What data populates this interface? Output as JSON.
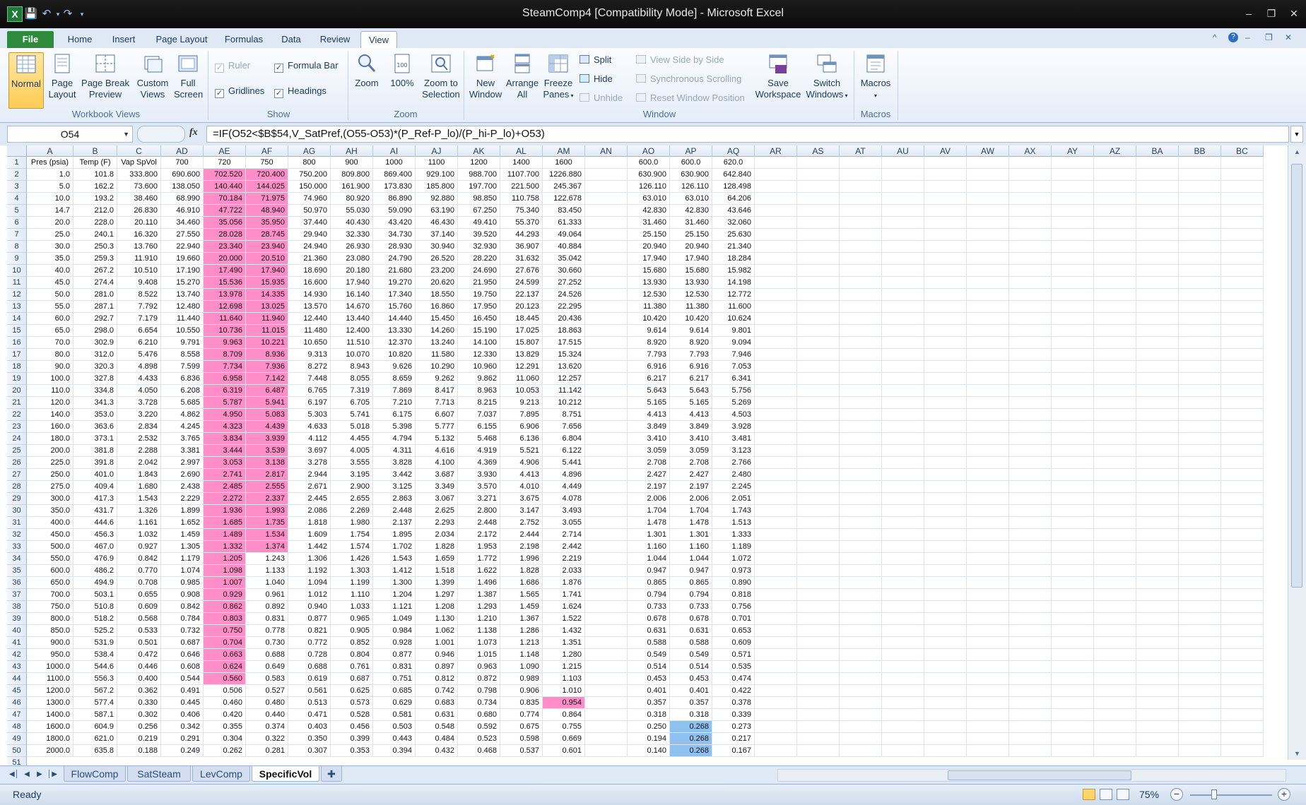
{
  "window": {
    "title": "SteamComp4  [Compatibility Mode]  -  Microsoft Excel",
    "app_icon": "X"
  },
  "ribbon_tabs": [
    "File",
    "Home",
    "Insert",
    "Page Layout",
    "Formulas",
    "Data",
    "Review",
    "View"
  ],
  "active_tab": "View",
  "ribbon": {
    "workbook_views": {
      "label": "Workbook Views",
      "normal": "Normal",
      "page_layout": [
        "Page",
        "Layout"
      ],
      "page_break": [
        "Page Break",
        "Preview"
      ],
      "custom_views": [
        "Custom",
        "Views"
      ],
      "full_screen": [
        "Full",
        "Screen"
      ]
    },
    "show": {
      "label": "Show",
      "ruler": "Ruler",
      "formula_bar": "Formula Bar",
      "gridlines": "Gridlines",
      "headings": "Headings",
      "ruler_checked": true,
      "formula_bar_checked": true,
      "gridlines_checked": true,
      "headings_checked": true
    },
    "zoom": {
      "label": "Zoom",
      "zoom": "Zoom",
      "hundred": "100%",
      "zoom_selection": [
        "Zoom to",
        "Selection"
      ]
    },
    "window": {
      "label": "Window",
      "new_window": [
        "New",
        "Window"
      ],
      "arrange_all": [
        "Arrange",
        "All"
      ],
      "freeze_panes": [
        "Freeze",
        "Panes"
      ],
      "split": "Split",
      "hide": "Hide",
      "unhide": "Unhide",
      "side_by_side": "View Side by Side",
      "sync_scroll": "Synchronous Scrolling",
      "reset_pos": "Reset Window Position",
      "save_workspace": [
        "Save",
        "Workspace"
      ],
      "switch_windows": [
        "Switch",
        "Windows"
      ]
    },
    "macros": {
      "label": "Macros",
      "macros": "Macros"
    }
  },
  "formula_bar": {
    "name_box": "O54",
    "fx": "fx",
    "formula": "=IF(O52<$B$54,V_SatPref,(O55-O53)*(P_Ref-P_lo)/(P_hi-P_lo)+O53)"
  },
  "sheet": {
    "columns": [
      "A",
      "B",
      "C",
      "AD",
      "AE",
      "AF",
      "AG",
      "AH",
      "AI",
      "AJ",
      "AK",
      "AL",
      "AM",
      "AN",
      "AO",
      "AP",
      "AQ",
      "AR",
      "AS",
      "AT",
      "AU",
      "AV",
      "AW",
      "AX",
      "AY",
      "AZ",
      "BA",
      "BB",
      "BC"
    ],
    "header_row": [
      "Pres (psia)",
      "Temp (F)",
      "Vap SpVol",
      "700",
      "720",
      "750",
      "800",
      "900",
      "1000",
      "1100",
      "1200",
      "1400",
      "1600",
      "",
      "600.0",
      "600.0",
      "620.0"
    ],
    "rows": [
      [
        "1.0",
        "101.8",
        "333.800",
        "690.600",
        "702.520",
        "720.400",
        "750.200",
        "809.800",
        "869.400",
        "929.100",
        "988.700",
        "1107.700",
        "1226.880",
        "",
        "630.900",
        "630.900",
        "642.840"
      ],
      [
        "5.0",
        "162.2",
        "73.600",
        "138.050",
        "140.440",
        "144.025",
        "150.000",
        "161.900",
        "173.830",
        "185.800",
        "197.700",
        "221.500",
        "245.367",
        "",
        "126.110",
        "126.110",
        "128.498"
      ],
      [
        "10.0",
        "193.2",
        "38.460",
        "68.990",
        "70.184",
        "71.975",
        "74.960",
        "80.920",
        "86.890",
        "92.880",
        "98.850",
        "110.758",
        "122.678",
        "",
        "63.010",
        "63.010",
        "64.206"
      ],
      [
        "14.7",
        "212.0",
        "26.830",
        "46.910",
        "47.722",
        "48.940",
        "50.970",
        "55.030",
        "59.090",
        "63.190",
        "67.250",
        "75.340",
        "83.450",
        "",
        "42.830",
        "42.830",
        "43.646"
      ],
      [
        "20.0",
        "228.0",
        "20.110",
        "34.460",
        "35.056",
        "35.950",
        "37.440",
        "40.430",
        "43.420",
        "46.430",
        "49.410",
        "55.370",
        "61.333",
        "",
        "31.460",
        "31.460",
        "32.060"
      ],
      [
        "25.0",
        "240.1",
        "16.320",
        "27.550",
        "28.028",
        "28.745",
        "29.940",
        "32.330",
        "34.730",
        "37.140",
        "39.520",
        "44.293",
        "49.064",
        "",
        "25.150",
        "25.150",
        "25.630"
      ],
      [
        "30.0",
        "250.3",
        "13.760",
        "22.940",
        "23.340",
        "23.940",
        "24.940",
        "26.930",
        "28.930",
        "30.940",
        "32.930",
        "36.907",
        "40.884",
        "",
        "20.940",
        "20.940",
        "21.340"
      ],
      [
        "35.0",
        "259.3",
        "11.910",
        "19.660",
        "20.000",
        "20.510",
        "21.360",
        "23.080",
        "24.790",
        "26.520",
        "28.220",
        "31.632",
        "35.042",
        "",
        "17.940",
        "17.940",
        "18.284"
      ],
      [
        "40.0",
        "267.2",
        "10.510",
        "17.190",
        "17.490",
        "17.940",
        "18.690",
        "20.180",
        "21.680",
        "23.200",
        "24.690",
        "27.676",
        "30.660",
        "",
        "15.680",
        "15.680",
        "15.982"
      ],
      [
        "45.0",
        "274.4",
        "9.408",
        "15.270",
        "15.536",
        "15.935",
        "16.600",
        "17.940",
        "19.270",
        "20.620",
        "21.950",
        "24.599",
        "27.252",
        "",
        "13.930",
        "13.930",
        "14.198"
      ],
      [
        "50.0",
        "281.0",
        "8.522",
        "13.740",
        "13.978",
        "14.335",
        "14.930",
        "16.140",
        "17.340",
        "18.550",
        "19.750",
        "22.137",
        "24.526",
        "",
        "12.530",
        "12.530",
        "12.772"
      ],
      [
        "55.0",
        "287.1",
        "7.792",
        "12.480",
        "12.698",
        "13.025",
        "13.570",
        "14.670",
        "15.760",
        "16.860",
        "17.950",
        "20.123",
        "22.295",
        "",
        "11.380",
        "11.380",
        "11.600"
      ],
      [
        "60.0",
        "292.7",
        "7.179",
        "11.440",
        "11.640",
        "11.940",
        "12.440",
        "13.440",
        "14.440",
        "15.450",
        "16.450",
        "18.445",
        "20.436",
        "",
        "10.420",
        "10.420",
        "10.624"
      ],
      [
        "65.0",
        "298.0",
        "6.654",
        "10.550",
        "10.736",
        "11.015",
        "11.480",
        "12.400",
        "13.330",
        "14.260",
        "15.190",
        "17.025",
        "18.863",
        "",
        "9.614",
        "9.614",
        "9.801"
      ],
      [
        "70.0",
        "302.9",
        "6.210",
        "9.791",
        "9.963",
        "10.221",
        "10.650",
        "11.510",
        "12.370",
        "13.240",
        "14.100",
        "15.807",
        "17.515",
        "",
        "8.920",
        "8.920",
        "9.094"
      ],
      [
        "80.0",
        "312.0",
        "5.476",
        "8.558",
        "8.709",
        "8.936",
        "9.313",
        "10.070",
        "10.820",
        "11.580",
        "12.330",
        "13.829",
        "15.324",
        "",
        "7.793",
        "7.793",
        "7.946"
      ],
      [
        "90.0",
        "320.3",
        "4.898",
        "7.599",
        "7.734",
        "7.936",
        "8.272",
        "8.943",
        "9.626",
        "10.290",
        "10.960",
        "12.291",
        "13.620",
        "",
        "6.916",
        "6.916",
        "7.053"
      ],
      [
        "100.0",
        "327.8",
        "4.433",
        "6.836",
        "6.958",
        "7.142",
        "7.448",
        "8.055",
        "8.659",
        "9.262",
        "9.862",
        "11.060",
        "12.257",
        "",
        "6.217",
        "6.217",
        "6.341"
      ],
      [
        "110.0",
        "334.8",
        "4.050",
        "6.208",
        "6.319",
        "6.487",
        "6.765",
        "7.319",
        "7.869",
        "8.417",
        "8.963",
        "10.053",
        "11.142",
        "",
        "5.643",
        "5.643",
        "5.756"
      ],
      [
        "120.0",
        "341.3",
        "3.728",
        "5.685",
        "5.787",
        "5.941",
        "6.197",
        "6.705",
        "7.210",
        "7.713",
        "8.215",
        "9.213",
        "10.212",
        "",
        "5.165",
        "5.165",
        "5.269"
      ],
      [
        "140.0",
        "353.0",
        "3.220",
        "4.862",
        "4.950",
        "5.083",
        "5.303",
        "5.741",
        "6.175",
        "6.607",
        "7.037",
        "7.895",
        "8.751",
        "",
        "4.413",
        "4.413",
        "4.503"
      ],
      [
        "160.0",
        "363.6",
        "2.834",
        "4.245",
        "4.323",
        "4.439",
        "4.633",
        "5.018",
        "5.398",
        "5.777",
        "6.155",
        "6.906",
        "7.656",
        "",
        "3.849",
        "3.849",
        "3.928"
      ],
      [
        "180.0",
        "373.1",
        "2.532",
        "3.765",
        "3.834",
        "3.939",
        "4.112",
        "4.455",
        "4.794",
        "5.132",
        "5.468",
        "6.136",
        "6.804",
        "",
        "3.410",
        "3.410",
        "3.481"
      ],
      [
        "200.0",
        "381.8",
        "2.288",
        "3.381",
        "3.444",
        "3.539",
        "3.697",
        "4.005",
        "4.311",
        "4.616",
        "4.919",
        "5.521",
        "6.122",
        "",
        "3.059",
        "3.059",
        "3.123"
      ],
      [
        "225.0",
        "391.8",
        "2.042",
        "2.997",
        "3.053",
        "3.138",
        "3.278",
        "3.555",
        "3.828",
        "4.100",
        "4.369",
        "4.906",
        "5.441",
        "",
        "2.708",
        "2.708",
        "2.766"
      ],
      [
        "250.0",
        "401.0",
        "1.843",
        "2.690",
        "2.741",
        "2.817",
        "2.944",
        "3.195",
        "3.442",
        "3.687",
        "3.930",
        "4.413",
        "4.896",
        "",
        "2.427",
        "2.427",
        "2.480"
      ],
      [
        "275.0",
        "409.4",
        "1.680",
        "2.438",
        "2.485",
        "2.555",
        "2.671",
        "2.900",
        "3.125",
        "3.349",
        "3.570",
        "4.010",
        "4.449",
        "",
        "2.197",
        "2.197",
        "2.245"
      ],
      [
        "300.0",
        "417.3",
        "1.543",
        "2.229",
        "2.272",
        "2.337",
        "2.445",
        "2.655",
        "2.863",
        "3.067",
        "3.271",
        "3.675",
        "4.078",
        "",
        "2.006",
        "2.006",
        "2.051"
      ],
      [
        "350.0",
        "431.7",
        "1.326",
        "1.899",
        "1.936",
        "1.993",
        "2.086",
        "2.269",
        "2.448",
        "2.625",
        "2.800",
        "3.147",
        "3.493",
        "",
        "1.704",
        "1.704",
        "1.743"
      ],
      [
        "400.0",
        "444.6",
        "1.161",
        "1.652",
        "1.685",
        "1.735",
        "1.818",
        "1.980",
        "2.137",
        "2.293",
        "2.448",
        "2.752",
        "3.055",
        "",
        "1.478",
        "1.478",
        "1.513"
      ],
      [
        "450.0",
        "456.3",
        "1.032",
        "1.459",
        "1.489",
        "1.534",
        "1.609",
        "1.754",
        "1.895",
        "2.034",
        "2.172",
        "2.444",
        "2.714",
        "",
        "1.301",
        "1.301",
        "1.333"
      ],
      [
        "500.0",
        "467.0",
        "0.927",
        "1.305",
        "1.332",
        "1.374",
        "1.442",
        "1.574",
        "1.702",
        "1.828",
        "1.953",
        "2.198",
        "2.442",
        "",
        "1.160",
        "1.160",
        "1.189"
      ],
      [
        "550.0",
        "476.9",
        "0.842",
        "1.179",
        "1.205",
        "1.243",
        "1.306",
        "1.426",
        "1.543",
        "1.659",
        "1.772",
        "1.996",
        "2.219",
        "",
        "1.044",
        "1.044",
        "1.072"
      ],
      [
        "600.0",
        "486.2",
        "0.770",
        "1.074",
        "1.098",
        "1.133",
        "1.192",
        "1.303",
        "1.412",
        "1.518",
        "1.622",
        "1.828",
        "2.033",
        "",
        "0.947",
        "0.947",
        "0.973"
      ],
      [
        "650.0",
        "494.9",
        "0.708",
        "0.985",
        "1.007",
        "1.040",
        "1.094",
        "1.199",
        "1.300",
        "1.399",
        "1.496",
        "1.686",
        "1.876",
        "",
        "0.865",
        "0.865",
        "0.890"
      ],
      [
        "700.0",
        "503.1",
        "0.655",
        "0.908",
        "0.929",
        "0.961",
        "1.012",
        "1.110",
        "1.204",
        "1.297",
        "1.387",
        "1.565",
        "1.741",
        "",
        "0.794",
        "0.794",
        "0.818"
      ],
      [
        "750.0",
        "510.8",
        "0.609",
        "0.842",
        "0.862",
        "0.892",
        "0.940",
        "1.033",
        "1.121",
        "1.208",
        "1.293",
        "1.459",
        "1.624",
        "",
        "0.733",
        "0.733",
        "0.756"
      ],
      [
        "800.0",
        "518.2",
        "0.568",
        "0.784",
        "0.803",
        "0.831",
        "0.877",
        "0.965",
        "1.049",
        "1.130",
        "1.210",
        "1.367",
        "1.522",
        "",
        "0.678",
        "0.678",
        "0.701"
      ],
      [
        "850.0",
        "525.2",
        "0.533",
        "0.732",
        "0.750",
        "0.778",
        "0.821",
        "0.905",
        "0.984",
        "1.062",
        "1.138",
        "1.286",
        "1.432",
        "",
        "0.631",
        "0.631",
        "0.653"
      ],
      [
        "900.0",
        "531.9",
        "0.501",
        "0.687",
        "0.704",
        "0.730",
        "0.772",
        "0.852",
        "0.928",
        "1.001",
        "1.073",
        "1.213",
        "1.351",
        "",
        "0.588",
        "0.588",
        "0.609"
      ],
      [
        "950.0",
        "538.4",
        "0.472",
        "0.646",
        "0.663",
        "0.688",
        "0.728",
        "0.804",
        "0.877",
        "0.946",
        "1.015",
        "1.148",
        "1.280",
        "",
        "0.549",
        "0.549",
        "0.571"
      ],
      [
        "1000.0",
        "544.6",
        "0.446",
        "0.608",
        "0.624",
        "0.649",
        "0.688",
        "0.761",
        "0.831",
        "0.897",
        "0.963",
        "1.090",
        "1.215",
        "",
        "0.514",
        "0.514",
        "0.535"
      ],
      [
        "1100.0",
        "556.3",
        "0.400",
        "0.544",
        "0.560",
        "0.583",
        "0.619",
        "0.687",
        "0.751",
        "0.812",
        "0.872",
        "0.989",
        "1.103",
        "",
        "0.453",
        "0.453",
        "0.474"
      ],
      [
        "1200.0",
        "567.2",
        "0.362",
        "0.491",
        "0.506",
        "0.527",
        "0.561",
        "0.625",
        "0.685",
        "0.742",
        "0.798",
        "0.906",
        "1.010",
        "",
        "0.401",
        "0.401",
        "0.422"
      ],
      [
        "1300.0",
        "577.4",
        "0.330",
        "0.445",
        "0.460",
        "0.480",
        "0.513",
        "0.573",
        "0.629",
        "0.683",
        "0.734",
        "0.835",
        "0.954",
        "",
        "0.357",
        "0.357",
        "0.378"
      ],
      [
        "1400.0",
        "587.1",
        "0.302",
        "0.406",
        "0.420",
        "0.440",
        "0.471",
        "0.528",
        "0.581",
        "0.631",
        "0.680",
        "0.774",
        "0.864",
        "",
        "0.318",
        "0.318",
        "0.339"
      ],
      [
        "1600.0",
        "604.9",
        "0.256",
        "0.342",
        "0.355",
        "0.374",
        "0.403",
        "0.456",
        "0.503",
        "0.548",
        "0.592",
        "0.675",
        "0.755",
        "",
        "0.250",
        "0.268",
        "0.273"
      ],
      [
        "1800.0",
        "621.0",
        "0.219",
        "0.291",
        "0.304",
        "0.322",
        "0.350",
        "0.399",
        "0.443",
        "0.484",
        "0.523",
        "0.598",
        "0.669",
        "",
        "0.194",
        "0.268",
        "0.217"
      ],
      [
        "2000.0",
        "635.8",
        "0.188",
        "0.249",
        "0.262",
        "0.281",
        "0.307",
        "0.353",
        "0.394",
        "0.432",
        "0.468",
        "0.537",
        "0.601",
        "",
        "0.140",
        "0.268",
        "0.167"
      ]
    ],
    "colors": {
      "pink": "#ff8dc7",
      "blue": "#8ec1f0"
    },
    "pink_ranges": [
      {
        "col": 4,
        "from": 2,
        "to": 44
      },
      {
        "col": 5,
        "from": 2,
        "to": 33
      },
      {
        "col": 12,
        "from": 46,
        "to": 46
      }
    ],
    "blue_ranges": [
      {
        "col": 15,
        "from": 48,
        "to": 50
      }
    ],
    "last_row_number": "51"
  },
  "sheet_tabs": [
    "FlowComp",
    "SatSteam",
    "LevComp",
    "SpecificVol"
  ],
  "active_sheet": "SpecificVol",
  "status": {
    "ready": "Ready",
    "zoom": "75%"
  }
}
